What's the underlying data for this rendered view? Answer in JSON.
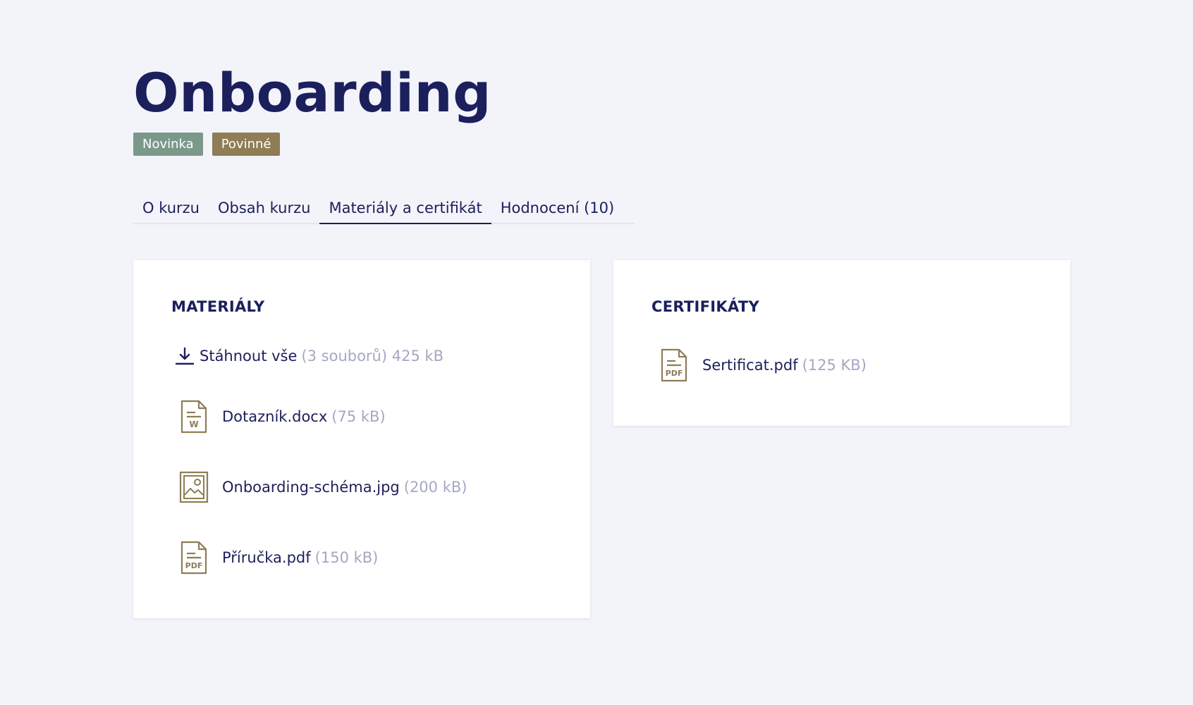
{
  "course": {
    "title": "Onboarding",
    "badges": [
      {
        "label": "Novinka",
        "color": "#7a998a"
      },
      {
        "label": "Povinné",
        "color": "#8e7d55"
      }
    ]
  },
  "tabs": [
    {
      "label": "O kurzu",
      "active": false
    },
    {
      "label": "Obsah kurzu",
      "active": false
    },
    {
      "label": "Materiály a certifikát",
      "active": true
    },
    {
      "label": "Hodnocení (10)",
      "active": false
    }
  ],
  "materials": {
    "heading": "MATERIÁLY",
    "download_all": {
      "icon": "download-icon",
      "label": "Stáhnout vše",
      "meta": "(3 souborů) 425 kB"
    },
    "files": [
      {
        "icon": "word-document-icon",
        "name": "Dotazník.docx",
        "size": "(75 kB)"
      },
      {
        "icon": "image-file-icon",
        "name": "Onboarding-schéma.jpg",
        "size": "(200 kB)"
      },
      {
        "icon": "pdf-file-icon",
        "name": "Příručka.pdf",
        "size": "(150 kB)"
      }
    ]
  },
  "certificates": {
    "heading": "CERTIFIKÁTY",
    "files": [
      {
        "icon": "pdf-file-icon",
        "name": "Sertificat.pdf",
        "size": "(125 KB)"
      }
    ]
  },
  "colors": {
    "background": "#f3f4fa",
    "text_primary": "#1c1f5a",
    "text_muted": "#a4a8c2",
    "icon_accent": "#8e7d55"
  }
}
